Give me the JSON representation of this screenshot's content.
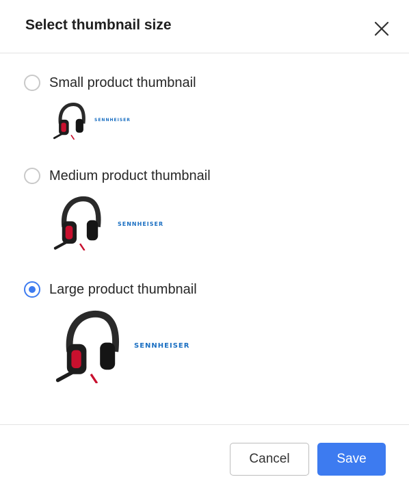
{
  "dialog": {
    "title": "Select thumbnail size",
    "close_icon": "close-icon"
  },
  "options": [
    {
      "label": "Small product thumbnail",
      "selected": false,
      "brand": "SENNHEISER"
    },
    {
      "label": "Medium product thumbnail",
      "selected": false,
      "brand": "SENNHEISER"
    },
    {
      "label": "Large product thumbnail",
      "selected": true,
      "brand": "SENNHEISER"
    }
  ],
  "footer": {
    "cancel_label": "Cancel",
    "save_label": "Save"
  },
  "colors": {
    "accent": "#3d7bf0",
    "brand_blue": "#1a6fc2",
    "headset_red": "#c8102e"
  }
}
